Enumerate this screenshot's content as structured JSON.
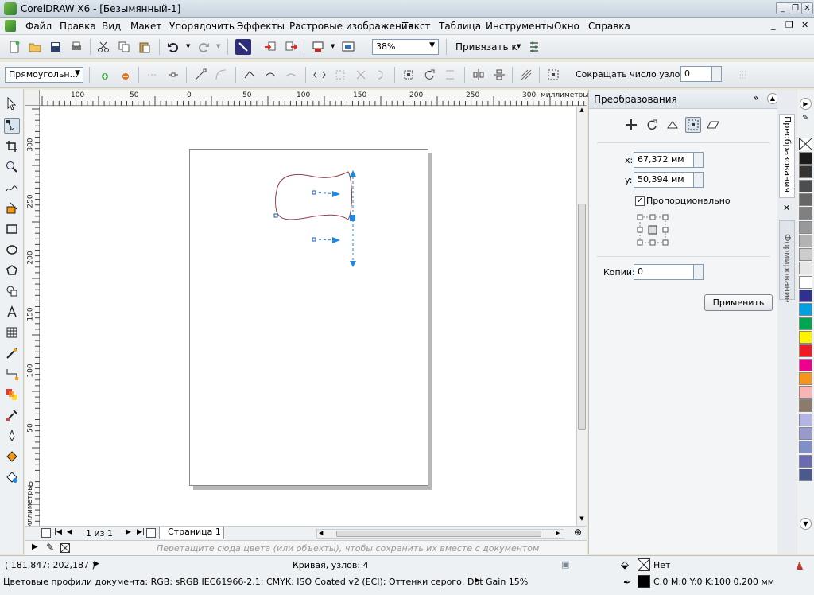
{
  "window": {
    "title": "CorelDRAW X6 - [Безымянный-1]"
  },
  "menu": [
    "Файл",
    "Правка",
    "Вид",
    "Макет",
    "Упорядочить",
    "Эффекты",
    "Растровые изображения",
    "Текст",
    "Таблица",
    "Инструменты",
    "Окно",
    "Справка"
  ],
  "toolbar": {
    "zoom": "38%",
    "snap_label": "Привязать к"
  },
  "propbar": {
    "shape_select": "Прямоугольн...",
    "reduce_nodes_label": "Сокращать число узлов",
    "reduce_nodes_value": "0"
  },
  "ruler": {
    "unit": "миллиметры",
    "h_ticks": [
      "100",
      "50",
      "0",
      "50",
      "100",
      "150",
      "200",
      "250",
      "300"
    ],
    "v_ticks": [
      "300",
      "250",
      "200",
      "150",
      "100",
      "50",
      "0"
    ]
  },
  "docker": {
    "title": "Преобразования",
    "x_label": "x:",
    "x_value": "67,372 мм",
    "y_label": "y:",
    "y_value": "50,394 мм",
    "proportional_label": "Пропорционально",
    "proportional_checked": true,
    "copies_label": "Копии:",
    "copies_value": "0",
    "apply_label": "Применить",
    "tab_transform": "Преобразования",
    "tab_shaping": "Формирование"
  },
  "pagebar": {
    "page_count": "1 из 1",
    "page_tab": "Страница 1"
  },
  "colorbar": {
    "hint": "Перетащите сюда цвета (или объекты), чтобы сохранить их вместе с документом"
  },
  "status": {
    "coords": "( 181,847; 202,187 )",
    "object_info": "Кривая, узлов: 4",
    "color_profiles": "Цветовые профили документа: RGB: sRGB IEC61966-2.1; CMYK: ISO Coated v2 (ECI); Оттенки серого: Dot Gain 15%",
    "fill": "Нет",
    "outline": "C:0 M:0 Y:0 K:100  0,200 мм"
  },
  "palette_colors": [
    "#ffffff",
    "#1a1a1a",
    "#333333",
    "#4d4d4d",
    "#666666",
    "#808080",
    "#999999",
    "#b3b3b3",
    "#cccccc",
    "#e6e6e6",
    "#ffffff",
    "#2e3192",
    "#00a0e3",
    "#00a651",
    "#fff200",
    "#ed1c24",
    "#ec008c",
    "#f7941d",
    "#fbb4b4",
    "#8c7b6b",
    "#b3b3e6",
    "#9999cc",
    "#7f8fc7",
    "#6b6bb3",
    "#4a5a8c"
  ]
}
